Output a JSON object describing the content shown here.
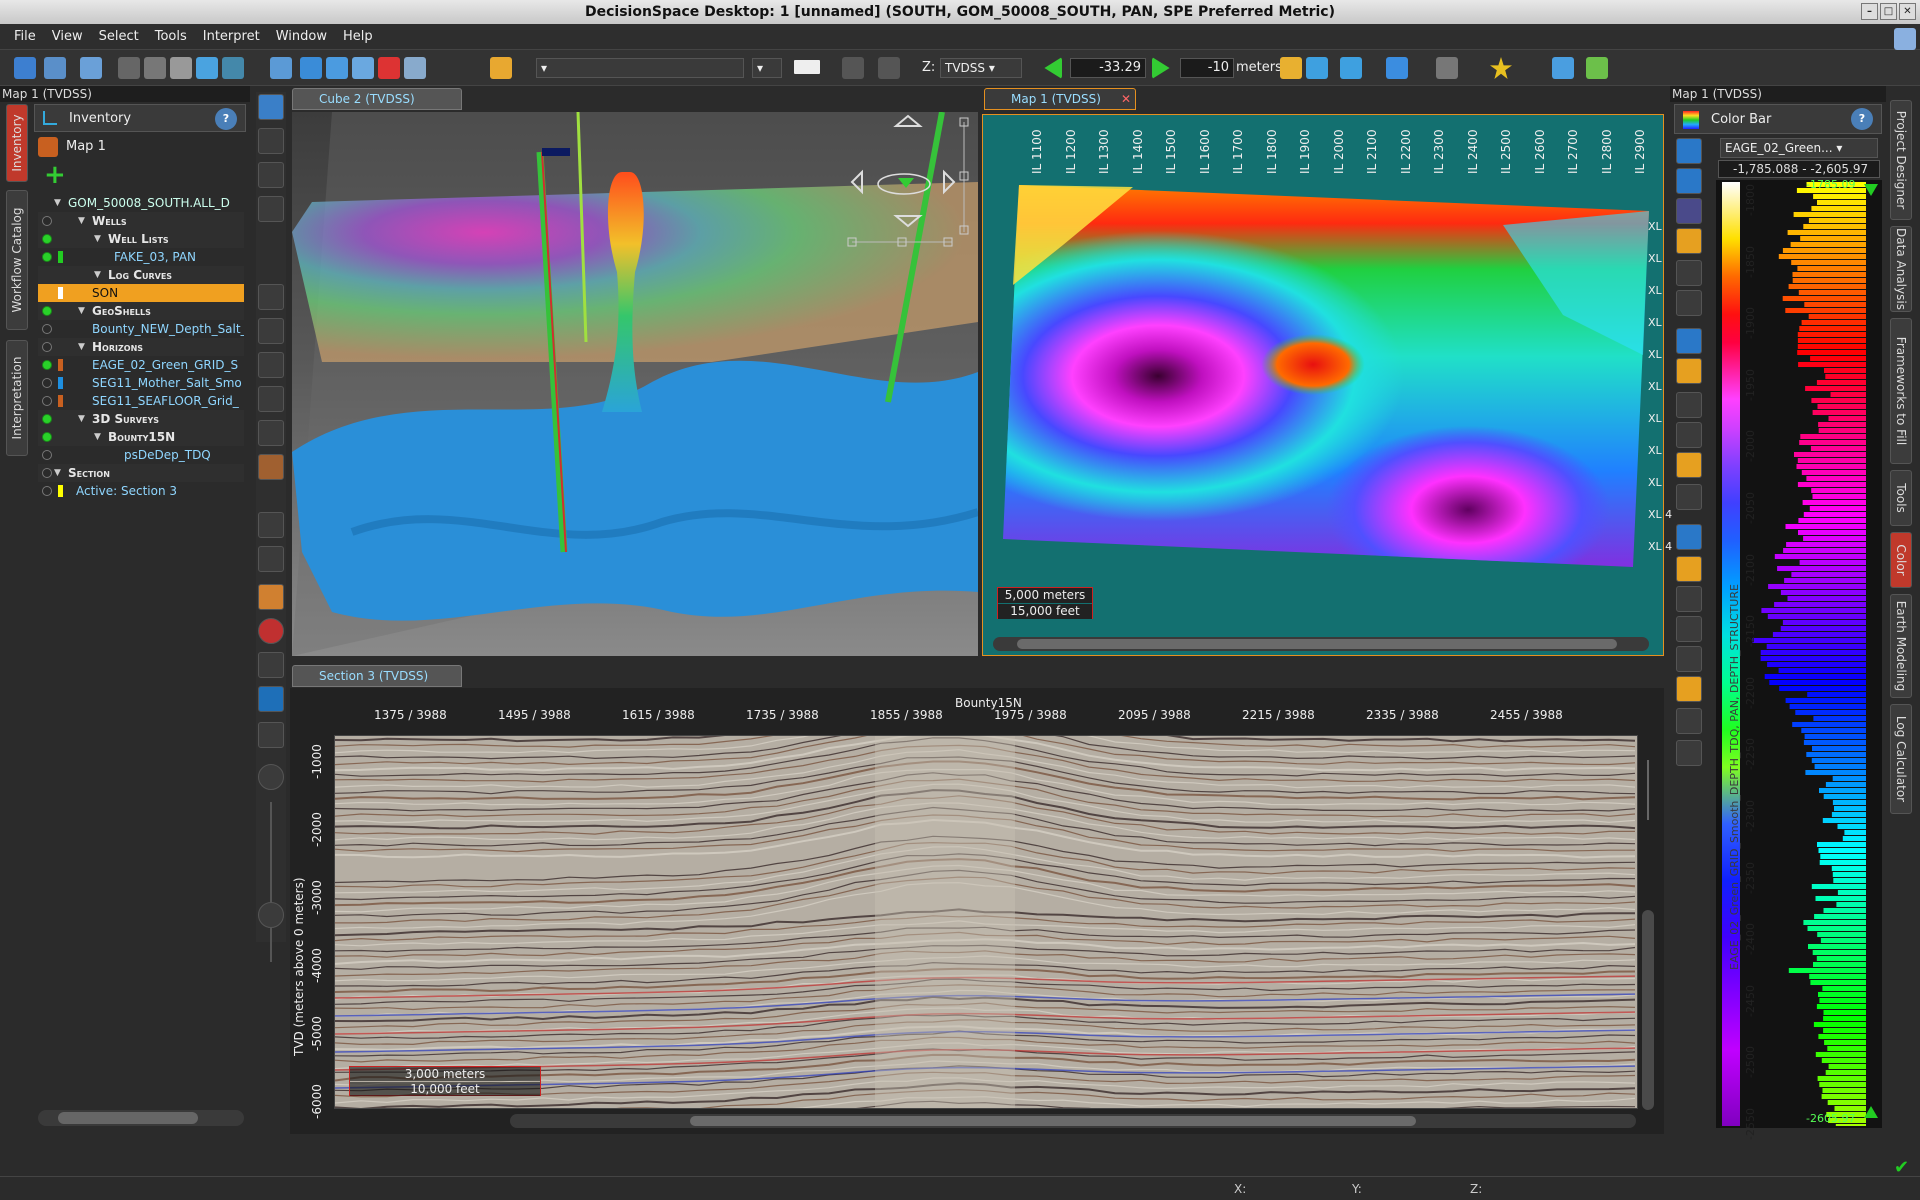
{
  "window": {
    "title": "DecisionSpace Desktop: 1 [unnamed] (SOUTH, GOM_50008_SOUTH, PAN, SPE Preferred Metric)"
  },
  "menu": [
    "File",
    "View",
    "Select",
    "Tools",
    "Interpret",
    "Window",
    "Help"
  ],
  "toolbar": {
    "z_label": "Z:",
    "z_domain": "TVDSS",
    "value1": "-33.29",
    "value2": "-10",
    "unit": "meters"
  },
  "left_panel": {
    "header": "Map 1 (TVDSS)",
    "title": "Inventory",
    "map_item": "Map 1",
    "vtabs": [
      "Inventory",
      "Workflow Catalog",
      "Interpretation"
    ],
    "tree": [
      {
        "label": "GOM_50008_SOUTH.ALL_D",
        "kind": "root"
      },
      {
        "label": "Wells",
        "kind": "group"
      },
      {
        "label": "Well Lists",
        "kind": "group"
      },
      {
        "label": "FAKE_03, PAN",
        "kind": "item"
      },
      {
        "label": "Log Curves",
        "kind": "group"
      },
      {
        "label": "SON",
        "kind": "selected"
      },
      {
        "label": "GeoShells",
        "kind": "group"
      },
      {
        "label": "Bounty_NEW_Depth_Salt_",
        "kind": "item"
      },
      {
        "label": "Horizons",
        "kind": "group"
      },
      {
        "label": "EAGE_02_Green_GRID_S",
        "kind": "item"
      },
      {
        "label": "SEG11_Mother_Salt_Smo",
        "kind": "item"
      },
      {
        "label": "SEG11_SEAFLOOR_Grid_",
        "kind": "item"
      },
      {
        "label": "3D Surveys",
        "kind": "group"
      },
      {
        "label": "Bounty15N",
        "kind": "group"
      },
      {
        "label": "psDeDep_TDQ",
        "kind": "item"
      },
      {
        "label": "Section",
        "kind": "group"
      },
      {
        "label": "Active: Section 3",
        "kind": "item"
      }
    ]
  },
  "views": {
    "cube_tab": "Cube 2 (TVDSS)",
    "map_tab": "Map 1 (TVDSS)",
    "section_tab": "Section 3 (TVDSS)"
  },
  "map": {
    "il_labels": [
      "IL 1100",
      "IL 1200",
      "IL 1300",
      "IL 1400",
      "IL 1500",
      "IL 1600",
      "IL 1700",
      "IL 1800",
      "IL 1900",
      "IL 2000",
      "IL 2100",
      "IL 2200",
      "IL 2300",
      "IL 2400",
      "IL 2500",
      "IL 2600",
      "IL 2700",
      "IL 2800",
      "IL 2900"
    ],
    "xl_labels": [
      "XL",
      "XL",
      "XL",
      "XL",
      "XL",
      "XL",
      "XL",
      "XL",
      "XL",
      "XL 4",
      "XL 4"
    ],
    "scale_m": "5,000 meters",
    "scale_ft": "15,000 feet"
  },
  "section": {
    "survey": "Bounty15N",
    "top_labels": [
      "1375 / 3988",
      "1495 / 3988",
      "1615 / 3988",
      "1735 / 3988",
      "1855 / 3988",
      "1975 / 3988",
      "2095 / 3988",
      "2215 / 3988",
      "2335 / 3988",
      "2455 / 3988"
    ],
    "y_axis_label": "TVD (meters above 0 meters)",
    "y_ticks": [
      "-1000",
      "-2000",
      "-3000",
      "-4000",
      "-5000",
      "-6000"
    ],
    "scale_m": "3,000 meters",
    "scale_ft": "10,000 feet"
  },
  "colorbar": {
    "header": "Map 1 (TVDSS)",
    "title": "Color Bar",
    "selected": "EAGE_02_Green...",
    "range": "-1,785.088 - -2,605.97",
    "top_value": "-1785.09",
    "bottom_value": "-2605.97",
    "ticks": [
      "-1800",
      "-1850",
      "-1900",
      "-1950",
      "-2000",
      "-2050",
      "-2100",
      "-2150",
      "-2200",
      "-2250",
      "-2300",
      "-2350",
      "-2400",
      "-2450",
      "-2500",
      "-2550"
    ],
    "vertical_label": "EAGE_02_Green_GRID_Smooth_DEPTH_TDQ, PAN, DEPTH_STRUCTURE",
    "side_tabs": [
      "Project Designer",
      "Data Analysis",
      "Frameworks to Fill",
      "Tools",
      "Color",
      "Earth Modeling",
      "Log Calculator"
    ]
  },
  "status": {
    "x": "X:",
    "y": "Y:",
    "z": "Z:"
  }
}
